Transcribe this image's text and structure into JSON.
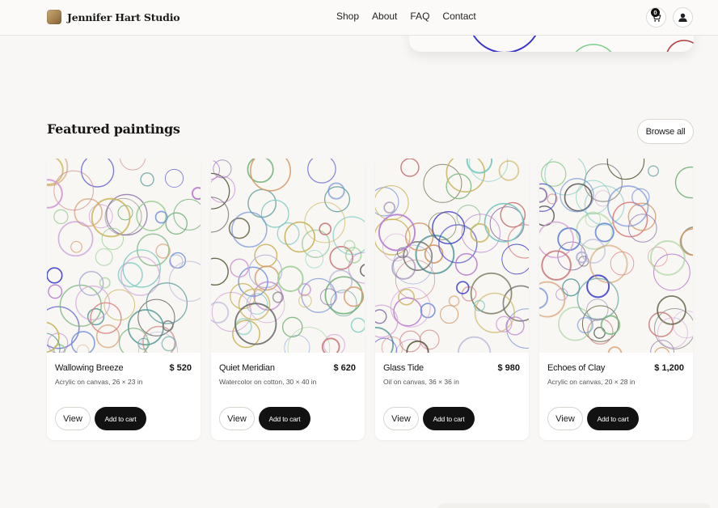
{
  "header": {
    "brand_name": "Jennifer Hart Studio",
    "nav": [
      "Shop",
      "About",
      "FAQ",
      "Contact"
    ],
    "cart_count": "0",
    "cart_icon": "cart-icon",
    "account_icon": "user-icon"
  },
  "section": {
    "title": "Featured paintings",
    "browse_label": "Browse all"
  },
  "products": [
    {
      "title": "Wallowing Breeze",
      "price": "$ 520",
      "meta": "Acrylic on canvas, 26 × 23 in",
      "view": "View",
      "add": "Add to cart"
    },
    {
      "title": "Quiet Meridian",
      "price": "$ 620",
      "meta": "Watercolor on cotton, 30 × 40 in",
      "view": "View",
      "add": "Add to cart"
    },
    {
      "title": "Glass Tide",
      "price": "$ 980",
      "meta": "Oil on canvas, 36 × 36 in",
      "view": "View",
      "add": "Add to cart"
    },
    {
      "title": "Echoes of Clay",
      "price": "$ 1,200",
      "meta": "Acrylic on canvas, 20 × 28 in",
      "view": "View",
      "add": "Add to cart"
    }
  ],
  "colors": {
    "accent_dark": "#121212",
    "background": "#f8f7f5",
    "circle_palette": [
      "#c97b7b",
      "#7bb77f",
      "#6f8fd6",
      "#b87bd0",
      "#c9b35a",
      "#5f9f9f",
      "#d59a6a",
      "#8a6fa8",
      "#6a6a6a",
      "#e08080",
      "#79c9c0",
      "#b0b0d8",
      "#3c3ccc",
      "#5a5a3a",
      "#9fd19a",
      "#d3a0d8"
    ]
  }
}
